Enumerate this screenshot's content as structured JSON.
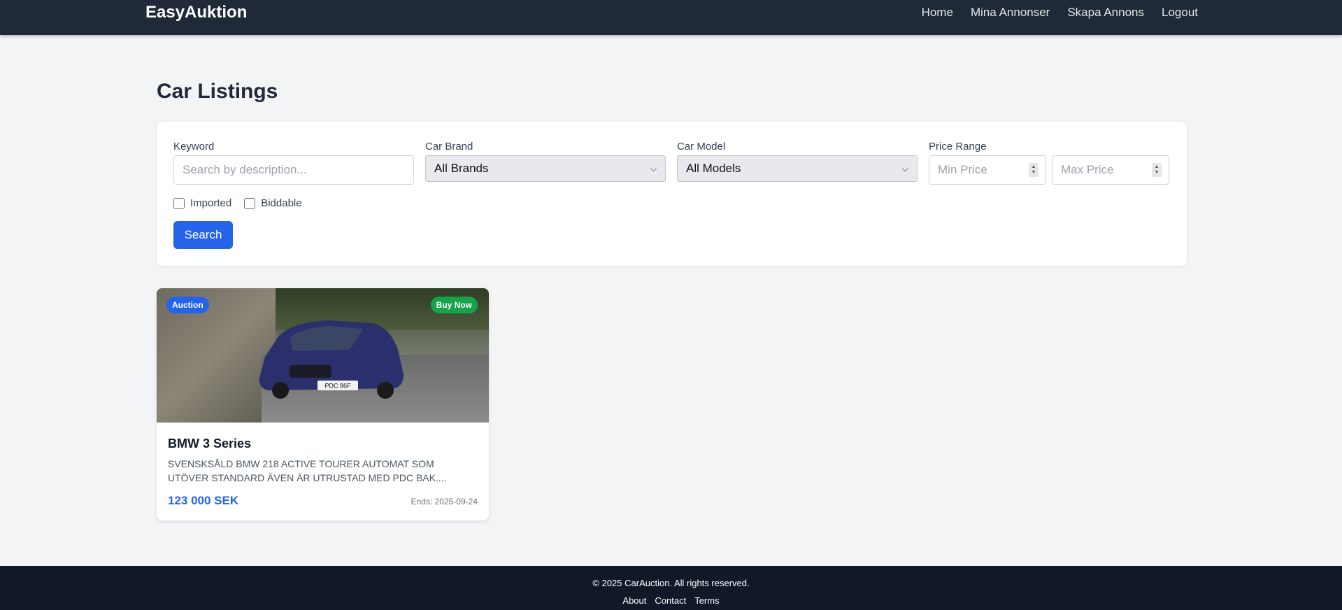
{
  "header": {
    "brand": "EasyAuktion",
    "nav": [
      "Home",
      "Mina Annonser",
      "Skapa Annons",
      "Logout"
    ]
  },
  "page": {
    "title": "Car Listings"
  },
  "filters": {
    "keyword_label": "Keyword",
    "keyword_placeholder": "Search by description...",
    "brand_label": "Car Brand",
    "brand_value": "All Brands",
    "model_label": "Car Model",
    "model_value": "All Models",
    "price_label": "Price Range",
    "min_placeholder": "Min Price",
    "max_placeholder": "Max Price",
    "imported_label": "Imported",
    "biddable_label": "Biddable",
    "search_label": "Search"
  },
  "listings": [
    {
      "title": "BMW 3 Series",
      "description": "SVENSKSÅLD BMW 218 ACTIVE TOURER AUTOMAT SOM UTÖVER STANDARD ÄVEN ÄR UTRUSTAD MED PDC BAK....",
      "price": "123 000 SEK",
      "ends": "Ends: 2025-09-24",
      "badge_left": "Auction",
      "badge_right": "Buy Now",
      "plate": "PDC 86F",
      "car_color": "#2b2f6b"
    }
  ],
  "footer": {
    "copyright": "© 2025 CarAuction. All rights reserved.",
    "links": [
      "About",
      "Contact",
      "Terms"
    ]
  }
}
